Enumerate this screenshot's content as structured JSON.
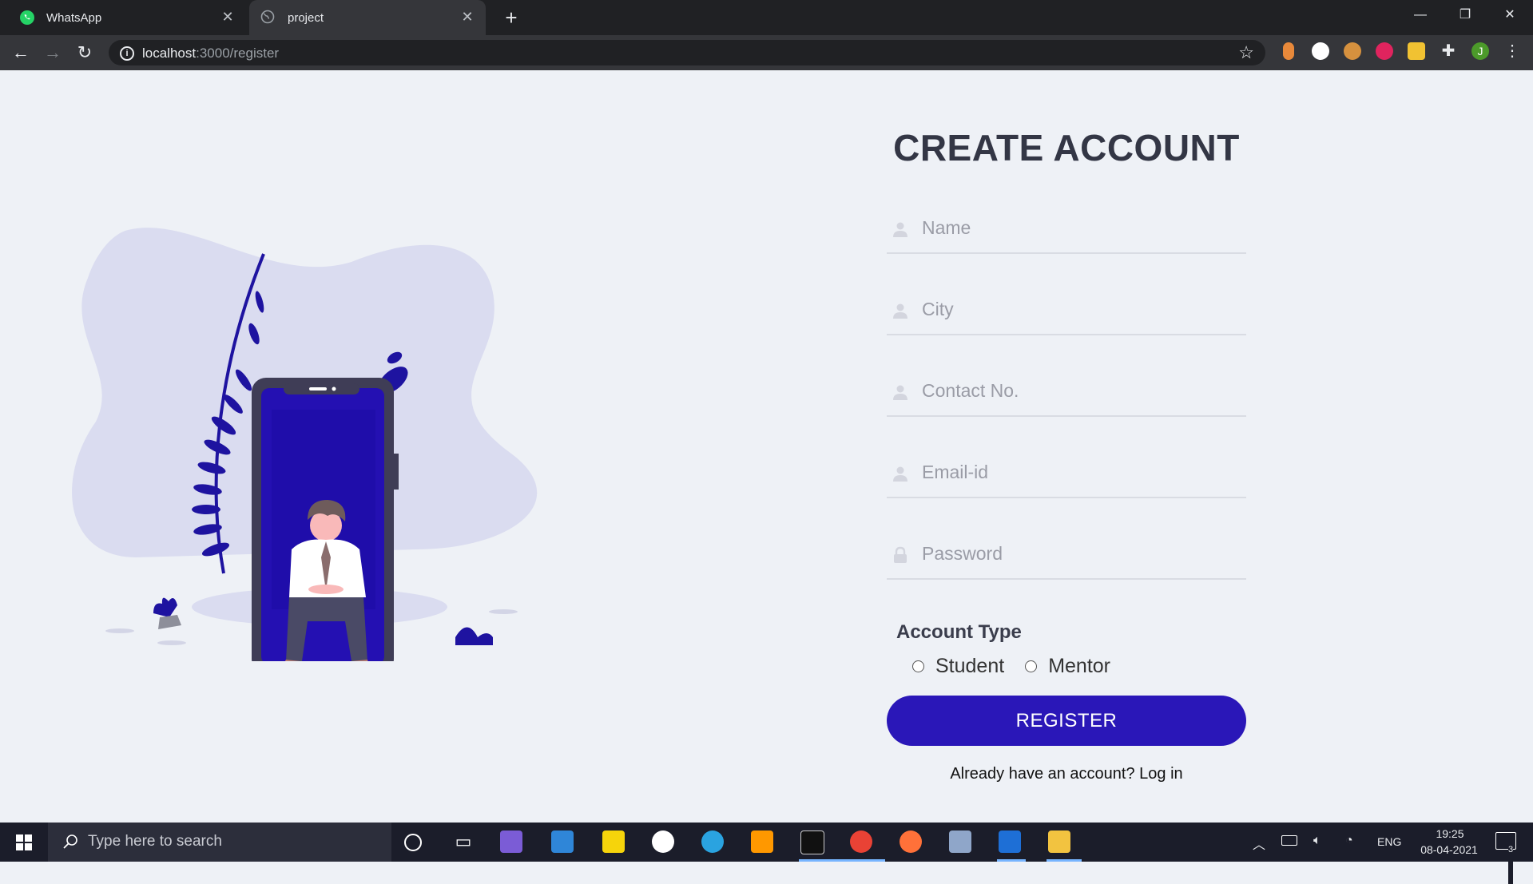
{
  "browser": {
    "tabs": [
      {
        "title": "WhatsApp",
        "icon": "whatsapp-icon"
      },
      {
        "title": "project",
        "icon": "globe-icon",
        "active": true
      }
    ],
    "url_host": "localhost",
    "url_path": ":3000/register",
    "extensions": [
      "honey-icon",
      "extension-circle-icon",
      "cookie-icon",
      "meesho-icon",
      "picture-icon",
      "puzzle-icon"
    ],
    "profile_initial": "J"
  },
  "form": {
    "title": "CREATE ACCOUNT",
    "fields": [
      {
        "placeholder": "Name",
        "icon": "user-icon"
      },
      {
        "placeholder": "City",
        "icon": "user-icon"
      },
      {
        "placeholder": "Contact No.",
        "icon": "user-icon"
      },
      {
        "placeholder": "Email-id",
        "icon": "user-icon"
      },
      {
        "placeholder": "Password",
        "icon": "lock-icon"
      }
    ],
    "account_type_label": "Account Type",
    "account_types": [
      "Student",
      "Mentor"
    ],
    "register_label": "REGISTER",
    "login_prompt": "Already have an account? Log in"
  },
  "colors": {
    "accent": "#2a17b8",
    "background": "#eef1f6",
    "heading": "#333645"
  },
  "taskbar": {
    "search_placeholder": "Type here to search",
    "language": "ENG",
    "time": "19:25",
    "date": "08-04-2021",
    "notifications": "3"
  }
}
